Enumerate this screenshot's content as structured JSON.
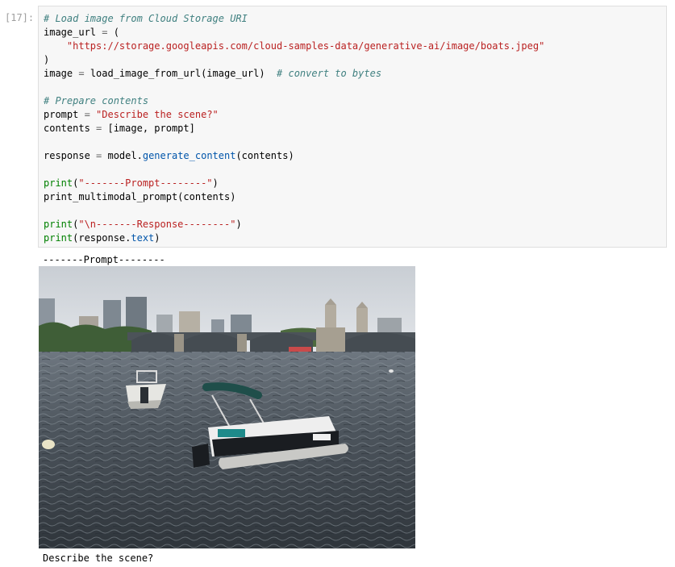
{
  "cell": {
    "prompt_number": "[17]:",
    "code": {
      "line1_comment": "# Load image from Cloud Storage URI",
      "line2_var": "image_url",
      "line2_eq": " = ",
      "line2_paren": "(",
      "line3_url": "\"https://storage.googleapis.com/cloud-samples-data/generative-ai/image/boats.jpeg\"",
      "line4_close": ")",
      "line5_var": "image",
      "line5_eq": " = ",
      "line5_call": "load_image_from_url(image_url)",
      "line5_comment": "# convert to bytes",
      "line7_comment": "# Prepare contents",
      "line8_var": "prompt",
      "line8_eq": " = ",
      "line8_str": "\"Describe the scene?\"",
      "line9_var": "contents",
      "line9_eq": " = ",
      "line9_val": "[image, prompt]",
      "line11_var": "response",
      "line11_eq": " = ",
      "line11_obj": "model.",
      "line11_fn": "generate_content",
      "line11_args": "(contents)",
      "line13_print": "print",
      "line13_open": "(",
      "line13_str": "\"-------Prompt--------\"",
      "line13_close": ")",
      "line14_call": "print_multimodal_prompt(contents)",
      "line16_print": "print",
      "line16_open": "(",
      "line16_str": "\"\\n-------Response--------\"",
      "line16_close": ")",
      "line17_print": "print",
      "line17_open": "(response.",
      "line17_attr": "text",
      "line17_close": ")"
    }
  },
  "output": {
    "prompt_header": "-------Prompt--------",
    "image_alt": "Pontoon boat and motorboat on a river in front of a bridge and city skyline",
    "prompt_text": "Describe the scene?"
  },
  "colors": {
    "comment": "#408080",
    "string": "#ba2121",
    "keyword": "#008000",
    "function": "#0055aa",
    "cell_background": "#f7f7f7"
  }
}
